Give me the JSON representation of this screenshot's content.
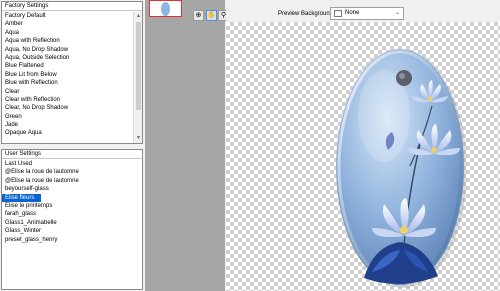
{
  "factory": {
    "heading": "Factory Settings",
    "items": [
      "Factory Default",
      "Amber",
      "Aqua",
      "Aqua with Reflection",
      "Aqua, No Drop Shadow",
      "Aqua, Outside Selection",
      "Blue Flattened",
      "Blue Lit from Below",
      "Blue with Reflection",
      "Clear",
      "Clear with Reflection",
      "Clear, No Drop Shadow",
      "Green",
      "Jade",
      "Opaque Aqua"
    ]
  },
  "user": {
    "heading": "User Settings",
    "items": [
      "Last Used",
      "@Elise la roue de lautomne",
      "@Elise la roue de lautomne",
      "beyourself-glass",
      "Elise fleurs",
      "Elise le printemps",
      "farah_glass",
      "Glass1_Animabelle",
      "Glass_Winter",
      "preset_glass_henry"
    ],
    "selected_index": 4
  },
  "toolbar": {
    "preview_background_label": "Preview Background:",
    "preview_background_value": "None",
    "tools": [
      "zoom-fit-icon",
      "hand-pan-icon",
      "zoom-magnifier-icon"
    ]
  },
  "colors": {
    "selection": "#0a64d0",
    "thumb_area": "#a6a6a6",
    "oval_glass": "#8fb6e0"
  }
}
